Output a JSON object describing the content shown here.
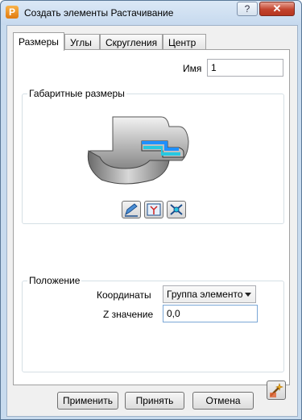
{
  "window": {
    "title": "Создать элементы Растачивание",
    "help_label": "?",
    "close_label": "✕"
  },
  "tabs": [
    {
      "label": "Размеры",
      "active": true
    },
    {
      "label": "Углы",
      "active": false
    },
    {
      "label": "Скругления",
      "active": false
    },
    {
      "label": "Центр",
      "active": false
    }
  ],
  "name": {
    "label": "Имя",
    "value": "1"
  },
  "dimensions": {
    "title": "Габаритные размеры",
    "buttons": [
      "edit-icon",
      "star-select-icon",
      "measure-icon"
    ]
  },
  "position": {
    "title": "Положение",
    "coordinates_label": "Координаты",
    "coordinates_value": "Группа элементо",
    "z_label": "Z значение",
    "z_value": "0,0"
  },
  "footer": {
    "apply_label": "Применить",
    "accept_label": "Принять",
    "cancel_label": "Отмена"
  },
  "colors": {
    "accent": "#1e90ff",
    "cyan": "#25c8e0",
    "close": "#c2432d"
  }
}
